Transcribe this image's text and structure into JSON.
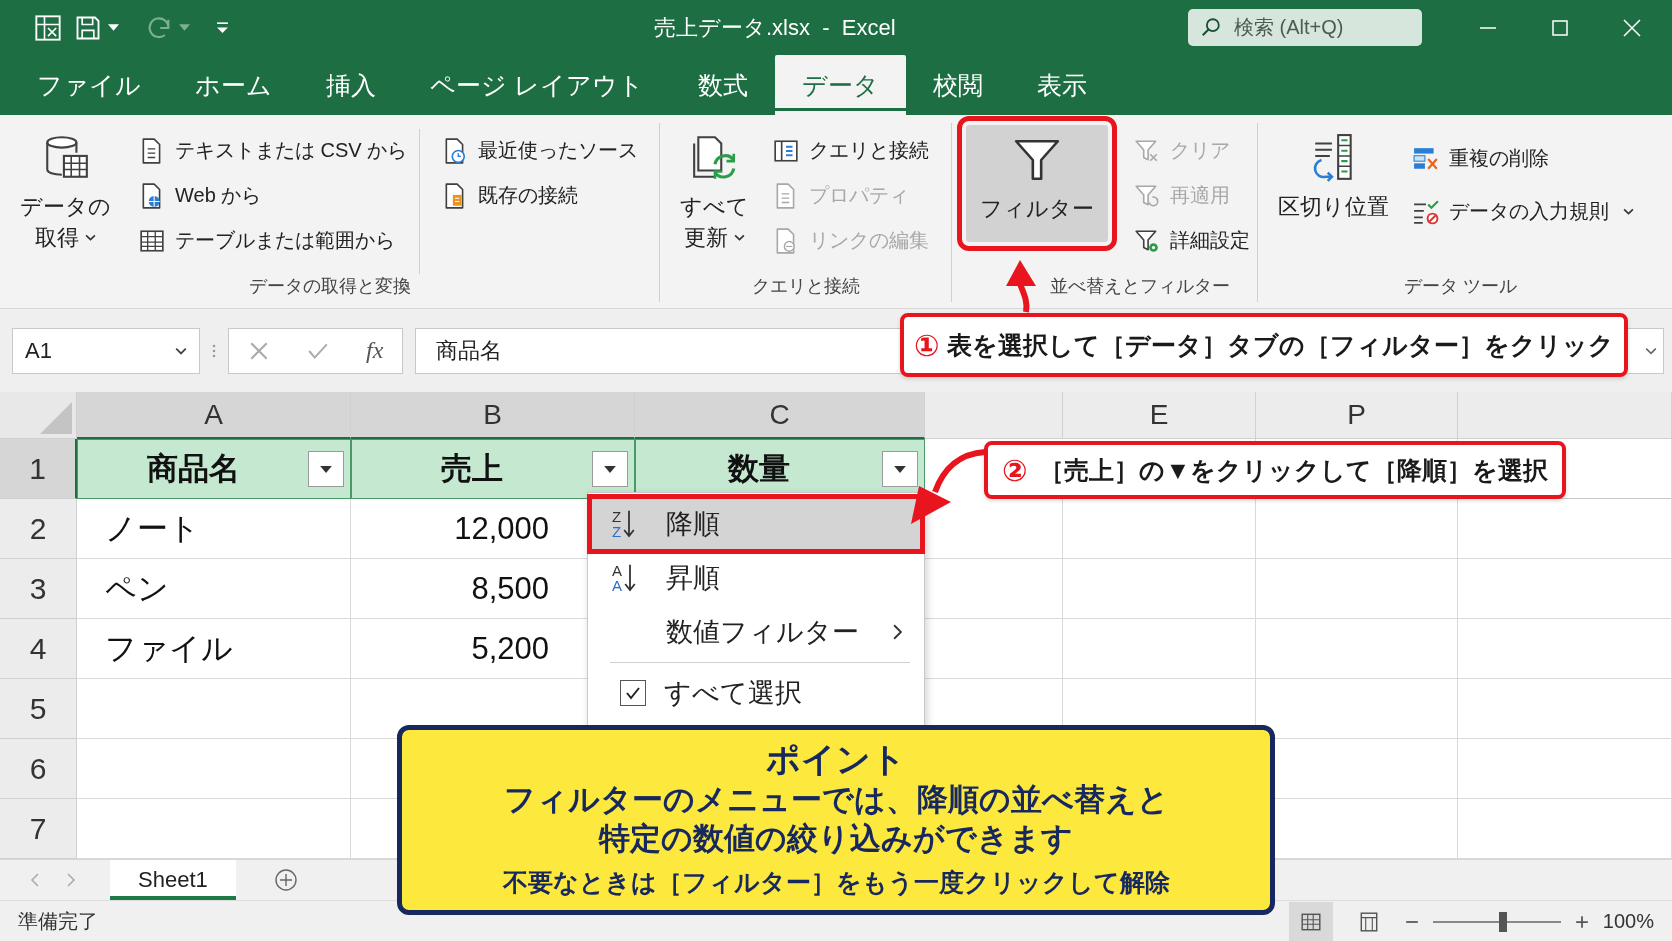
{
  "title_bar": {
    "title": "売上データ.xlsx  -  Excel",
    "search": {
      "placeholder": "検索 (Alt+Q)"
    }
  },
  "tabs": [
    {
      "label": "ファイル",
      "selected": false
    },
    {
      "label": "ホーム",
      "selected": false
    },
    {
      "label": "挿入",
      "selected": false
    },
    {
      "label": "ページ レイアウト",
      "selected": false
    },
    {
      "label": "数式",
      "selected": false
    },
    {
      "label": "データ",
      "selected": true
    },
    {
      "label": "校閲",
      "selected": false
    },
    {
      "label": "表示",
      "selected": false
    }
  ],
  "ribbon": {
    "groups": [
      {
        "label": "データの取得と変換",
        "columns": [
          {
            "kind": "large",
            "lines": [
              "データの",
              "取得"
            ],
            "dropdown": true,
            "selected": false
          },
          {
            "kind": "stack",
            "items": [
              {
                "label": "テキストまたは CSV から",
                "disabled": false,
                "dropdown": false
              },
              {
                "label": "Web から",
                "disabled": false,
                "dropdown": false
              },
              {
                "label": "テーブルまたは範囲から",
                "disabled": false,
                "dropdown": false
              }
            ]
          },
          {
            "kind": "stack",
            "items": [
              {
                "label": "最近使ったソース",
                "disabled": false,
                "dropdown": false
              },
              {
                "label": "既存の接続",
                "disabled": false,
                "dropdown": false
              }
            ]
          }
        ]
      },
      {
        "label": "クエリと接続",
        "columns": [
          {
            "kind": "large",
            "lines": [
              "すべて",
              "更新"
            ],
            "dropdown": true,
            "selected": false
          },
          {
            "kind": "stack",
            "items": [
              {
                "label": "クエリと接続",
                "disabled": false,
                "dropdown": false
              },
              {
                "label": "プロパティ",
                "disabled": true,
                "dropdown": false
              },
              {
                "label": "リンクの編集",
                "disabled": true,
                "dropdown": false
              }
            ]
          }
        ]
      },
      {
        "label": "並べ替えとフィルター",
        "columns": [
          {
            "kind": "large",
            "lines": [
              "フィルター"
            ],
            "dropdown": false,
            "selected": true
          },
          {
            "kind": "stack",
            "items": [
              {
                "label": "クリア",
                "disabled": true,
                "dropdown": false
              },
              {
                "label": "再適用",
                "disabled": true,
                "dropdown": false
              },
              {
                "label": "詳細設定",
                "disabled": false,
                "dropdown": false
              }
            ]
          }
        ]
      },
      {
        "label": "データ ツール",
        "columns": [
          {
            "kind": "large",
            "lines": [
              "区切り位置"
            ],
            "dropdown": false,
            "selected": false
          },
          {
            "kind": "stack",
            "items": [
              {
                "label": "重複の削除",
                "disabled": false,
                "dropdown": false
              },
              {
                "label": "データの入力規則",
                "disabled": false,
                "dropdown": true
              }
            ]
          }
        ]
      }
    ]
  },
  "formula_bar": {
    "name_box": "A1",
    "fx": "fx",
    "formula": "商品名"
  },
  "sheet": {
    "columns": [
      {
        "label": "A",
        "selected": true
      },
      {
        "label": "B",
        "selected": true
      },
      {
        "label": "C",
        "selected": true
      },
      {
        "selected": false
      },
      {
        "label": "E",
        "selected": false
      },
      {
        "label": "P",
        "selected": false
      },
      {
        "selected": false
      }
    ],
    "rows": [
      {
        "number": "1",
        "selected": true,
        "kind": "header",
        "cells": [
          "商品名",
          "売上",
          "数量"
        ]
      },
      {
        "number": "2",
        "selected": false,
        "kind": "data",
        "cells": [
          "ノート",
          "12,000"
        ]
      },
      {
        "number": "3",
        "selected": false,
        "kind": "data",
        "cells": [
          "ペン",
          "8,500"
        ]
      },
      {
        "number": "4",
        "selected": false,
        "kind": "data",
        "cells": [
          "ファイル",
          "5,200"
        ]
      },
      {
        "number": "5",
        "selected": false,
        "kind": "data"
      },
      {
        "number": "6",
        "selected": false,
        "kind": "data"
      },
      {
        "number": "7",
        "selected": false,
        "kind": "data"
      }
    ]
  },
  "filter_menu": {
    "items": [
      {
        "kind": "sort",
        "icon_letters": [
          "Z",
          "Z"
        ],
        "label": "降順",
        "selected": true
      },
      {
        "kind": "sort",
        "icon_letters": [
          "A",
          "A"
        ],
        "label": "昇順",
        "selected": false
      },
      {
        "kind": "submenu",
        "label": "数値フィルター",
        "selected": false
      },
      {
        "kind": "check",
        "label": "すべて選択",
        "checked": true,
        "selected": false
      }
    ]
  },
  "callouts": [
    {
      "number": "①",
      "text": "表を選択して［データ］タブの［フィルター］をクリック"
    },
    {
      "number": "②",
      "text": "［売上］の▼をクリックして［降順］を選択"
    }
  ],
  "point": {
    "title": "ポイント",
    "lines": [
      "フィルターのメニューでは、降順の並べ替えと",
      "特定の数値の絞り込みができます"
    ],
    "note": "不要なときは［フィルター］をもう一度クリックして解除"
  },
  "sheet_tabs": [
    {
      "label": "Sheet1",
      "selected": true
    }
  ],
  "status_bar": {
    "text": "準備完了",
    "views": [
      {
        "selected": true
      },
      {
        "selected": false
      }
    ],
    "zoom": {
      "level": 0.55,
      "reading": "100%"
    }
  }
}
